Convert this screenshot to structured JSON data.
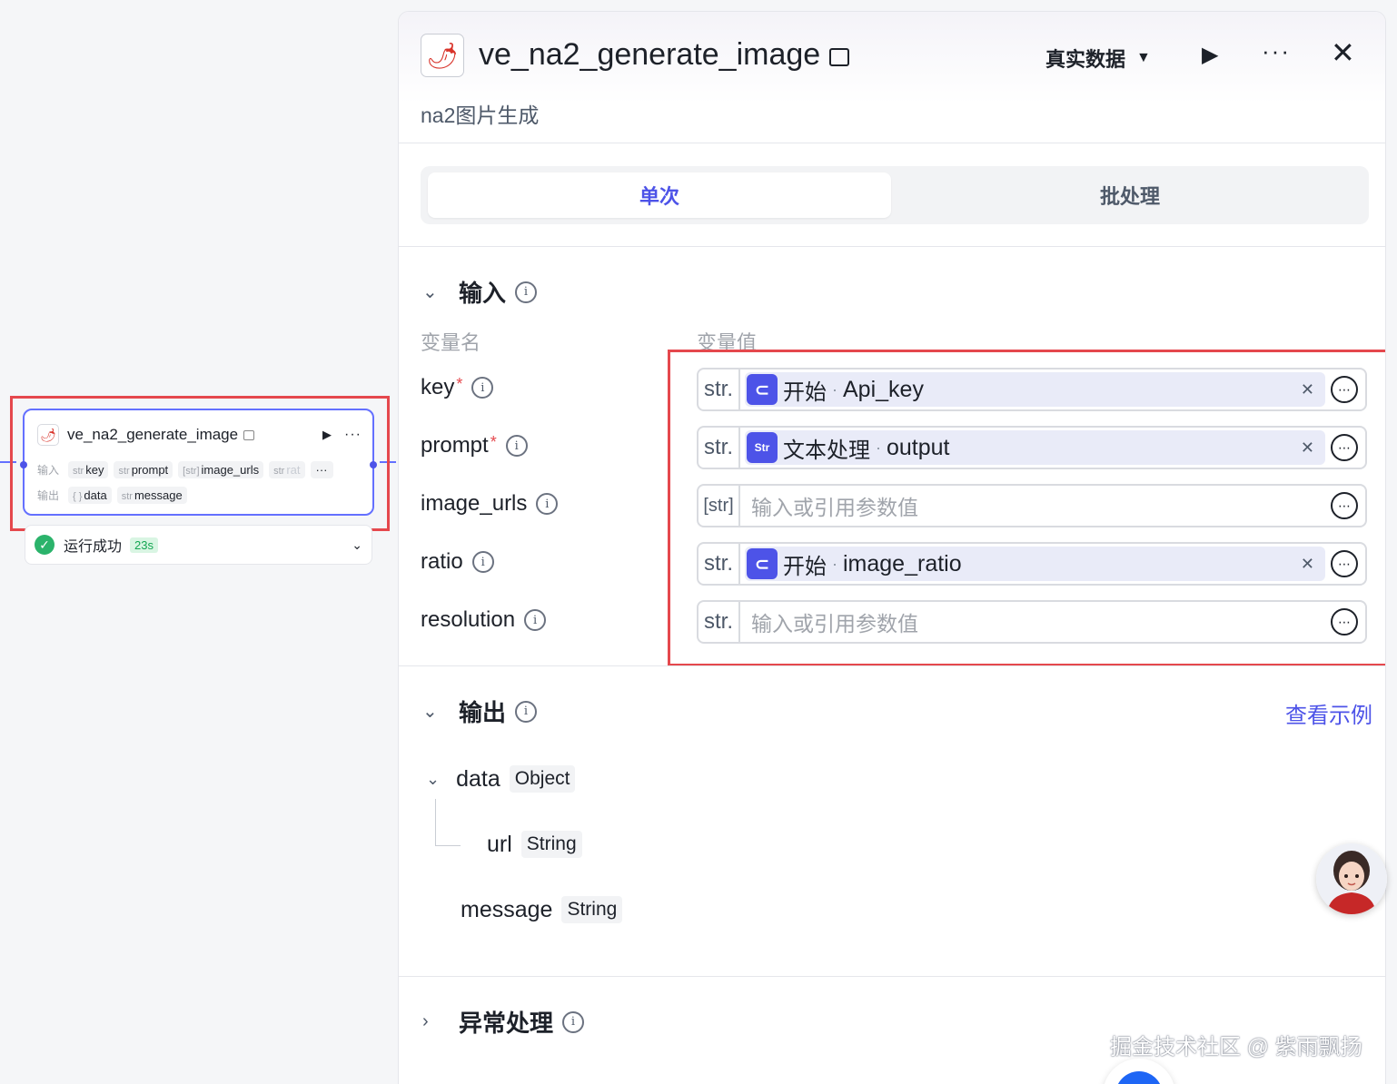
{
  "canvas_node": {
    "title": "ve_na2_generate_image",
    "input_label": "输入",
    "output_label": "输出",
    "inputs": [
      {
        "type": "str",
        "name": "key"
      },
      {
        "type": "str",
        "name": "prompt"
      },
      {
        "type": "[str]",
        "name": "image_urls"
      },
      {
        "type": "str",
        "name": "rat"
      }
    ],
    "more_label": "···",
    "outputs": [
      {
        "type": "{ }",
        "name": "data"
      },
      {
        "type": "str",
        "name": "message"
      }
    ],
    "status_text": "运行成功",
    "duration": "23s"
  },
  "panel": {
    "title": "ve_na2_generate_image",
    "subtitle": "na2图片生成",
    "mode_label": "真实数据",
    "tabs": [
      {
        "label": "单次",
        "active": true
      },
      {
        "label": "批处理",
        "active": false
      }
    ],
    "input_section": {
      "title": "输入",
      "col_name": "变量名",
      "col_value": "变量值",
      "fields": [
        {
          "name": "key",
          "required": true,
          "type": "str.",
          "ref_node": "开始",
          "ref_var": "Api_key",
          "ref_icon": "start"
        },
        {
          "name": "prompt",
          "required": true,
          "type": "str.",
          "ref_node": "文本处理",
          "ref_var": "output",
          "ref_icon": "text"
        },
        {
          "name": "image_urls",
          "required": false,
          "type": "[str]",
          "placeholder": "输入或引用参数值"
        },
        {
          "name": "ratio",
          "required": false,
          "type": "str.",
          "ref_node": "开始",
          "ref_var": "image_ratio",
          "ref_icon": "start"
        },
        {
          "name": "resolution",
          "required": false,
          "type": "str.",
          "placeholder": "输入或引用参数值"
        }
      ]
    },
    "output_section": {
      "title": "输出",
      "example_link": "查看示例",
      "items": [
        {
          "name": "data",
          "type": "Object"
        },
        {
          "name": "url",
          "type": "String"
        },
        {
          "name": "message",
          "type": "String"
        }
      ]
    },
    "error_section": {
      "title": "异常处理"
    }
  },
  "watermark": "掘金技术社区 @ 紫雨飘扬",
  "colors": {
    "accent": "#4d53e8",
    "highlight": "#e5484d",
    "success": "#2bb36b"
  }
}
